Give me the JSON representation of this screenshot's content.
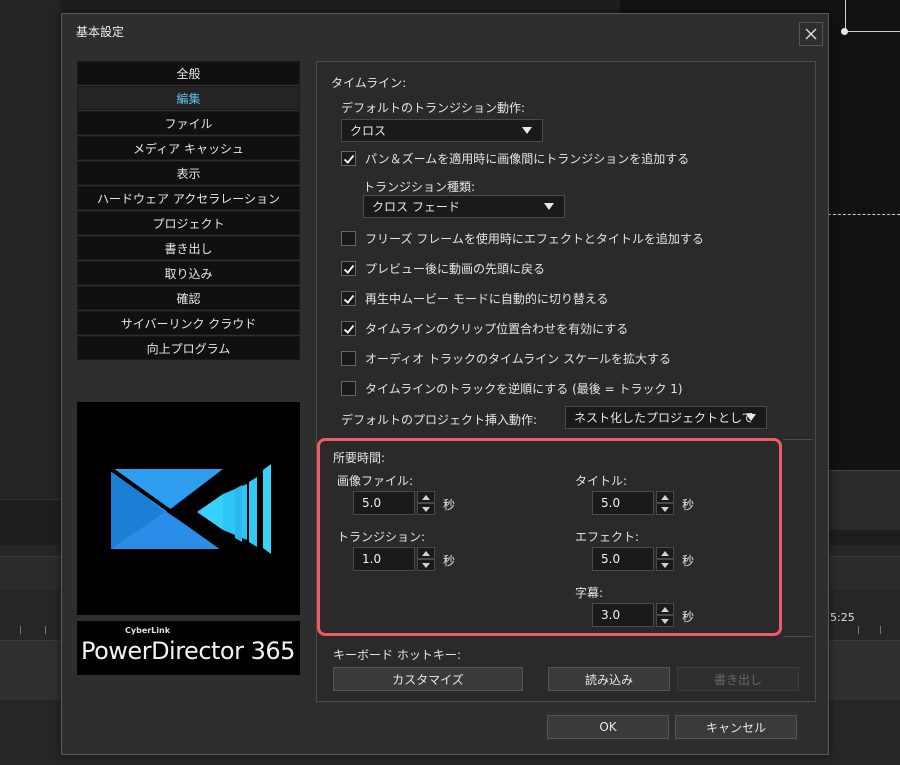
{
  "background": {
    "timecode": "5:25"
  },
  "dialog": {
    "title": "基本設定",
    "close_icon": "close-icon"
  },
  "nav": {
    "items": [
      {
        "label": "全般",
        "active": false
      },
      {
        "label": "編集",
        "active": true
      },
      {
        "label": "ファイル",
        "active": false
      },
      {
        "label": "メディア キャッシュ",
        "active": false
      },
      {
        "label": "表示",
        "active": false
      },
      {
        "label": "ハードウェア アクセラレーション",
        "active": false
      },
      {
        "label": "プロジェクト",
        "active": false
      },
      {
        "label": "書き出し",
        "active": false
      },
      {
        "label": "取り込み",
        "active": false
      },
      {
        "label": "確認",
        "active": false
      },
      {
        "label": "サイバーリンク クラウド",
        "active": false
      },
      {
        "label": "向上プログラム",
        "active": false
      }
    ]
  },
  "brand": {
    "small": "CyberLink",
    "name": "PowerDirector 365",
    "colors": {
      "logo_cyan": "#38d0ff",
      "logo_blue": "#2a8de8"
    }
  },
  "timeline": {
    "heading": "タイムライン:",
    "default_transition_label": "デフォルトのトランジション動作:",
    "default_transition_value": "クロス",
    "pan_zoom_label": "パン＆ズームを適用時に画像間にトランジションを追加する",
    "pan_zoom_checked": true,
    "transition_type_label": "トランジション種類:",
    "transition_type_value": "クロス フェード",
    "options": [
      {
        "label": "フリーズ フレームを使用時にエフェクトとタイトルを追加する",
        "checked": false
      },
      {
        "label": "プレビュー後に動画の先頭に戻る",
        "checked": true
      },
      {
        "label": "再生中ムービー モードに自動的に切り替える",
        "checked": true
      },
      {
        "label": "タイムラインのクリップ位置合わせを有効にする",
        "checked": true
      },
      {
        "label": "オーディオ トラックのタイムライン スケールを拡大する",
        "checked": false
      },
      {
        "label": "タイムラインのトラックを逆順にする (最後 = トラック 1)",
        "checked": false
      }
    ],
    "project_insert_label": "デフォルトのプロジェクト挿入動作:",
    "project_insert_value": "ネスト化したプロジェクトとして"
  },
  "duration": {
    "heading": "所要時間:",
    "unit": "秒",
    "image_file": {
      "label": "画像ファイル:",
      "value": "5.0"
    },
    "transition": {
      "label": "トランジション:",
      "value": "1.0"
    },
    "title": {
      "label": "タイトル:",
      "value": "5.0"
    },
    "effect": {
      "label": "エフェクト:",
      "value": "5.0"
    },
    "subtitle": {
      "label": "字幕:",
      "value": "3.0"
    },
    "highlight_color": "#f05b6b"
  },
  "hotkeys": {
    "label": "キーボード ホットキー:",
    "customize": "カスタマイズ",
    "import": "読み込み",
    "export": "書き出し"
  },
  "footer": {
    "ok": "OK",
    "cancel": "キャンセル"
  },
  "colors": {
    "accent": "#5fc3ec",
    "dialog_bg": "#2e2e2e"
  }
}
